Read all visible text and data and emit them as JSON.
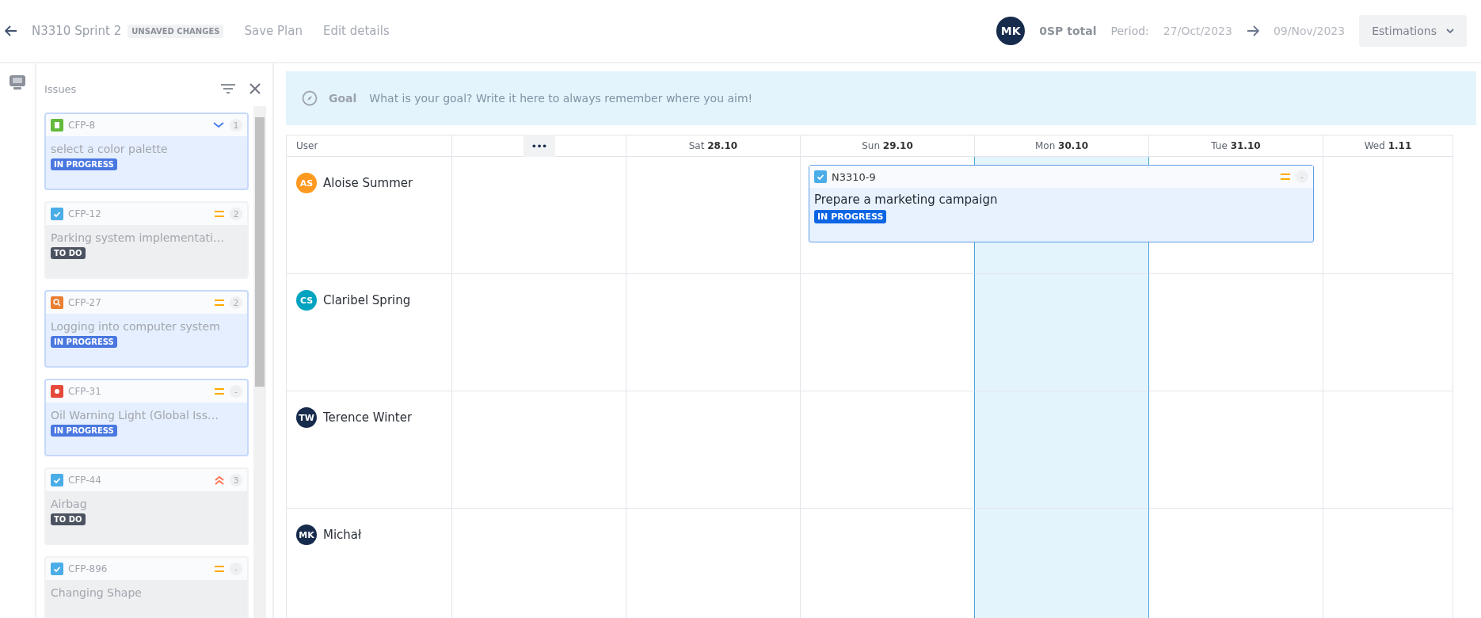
{
  "header": {
    "title": "N3310 Sprint 2",
    "badge": "UNSAVED CHANGES",
    "links": [
      "Save Plan",
      "Edit details"
    ],
    "avatar": {
      "initials": "MK",
      "color": "#172b4d"
    },
    "total": "0SP total",
    "period_label": "Period:",
    "period_start": "27/Oct/2023",
    "period_end": "09/Nov/2023",
    "button": "Estimations"
  },
  "sidebar": {
    "title": "Issues",
    "issues": [
      {
        "key": "CFP-8",
        "kind": "in_progress",
        "type_icon": {
          "kind": "story"
        },
        "priority_icon": {
          "kind": "low"
        },
        "points": "1",
        "title": "select a color palette",
        "status": "IN PROGRESS"
      },
      {
        "key": "CFP-12",
        "kind": "todo",
        "type_icon": {
          "kind": "task"
        },
        "priority_icon": {
          "kind": "medium"
        },
        "points": "2",
        "title": "Parking system implementati…",
        "status": "TO DO"
      },
      {
        "key": "CFP-27",
        "kind": "in_progress",
        "type_icon": {
          "kind": "search"
        },
        "priority_icon": {
          "kind": "medium"
        },
        "points": "2",
        "title": "Logging into computer system",
        "status": "IN PROGRESS"
      },
      {
        "key": "CFP-31",
        "kind": "in_progress",
        "type_icon": {
          "kind": "bug"
        },
        "priority_icon": {
          "kind": "medium"
        },
        "points": "-",
        "title": "Oil Warning Light (Global Iss…",
        "status": "IN PROGRESS"
      },
      {
        "key": "CFP-44",
        "kind": "todo",
        "type_icon": {
          "kind": "task"
        },
        "priority_icon": {
          "kind": "high"
        },
        "points": "3",
        "title": "Airbag",
        "status": "TO DO"
      },
      {
        "key": "CFP-896",
        "kind": "todo",
        "type_icon": {
          "kind": "task"
        },
        "priority_icon": {
          "kind": "medium"
        },
        "points": "-",
        "title": "Changing Shape"
      }
    ]
  },
  "goal": {
    "label": "Goal",
    "placeholder": "What is your goal? Write it here to always remember where you aim!"
  },
  "grid": {
    "user_header": "User",
    "more": "•••",
    "days": [
      {
        "weekday": "Sat",
        "date": "28.10",
        "today": false
      },
      {
        "weekday": "Sun",
        "date": "29.10",
        "today": false
      },
      {
        "weekday": "Mon",
        "date": "30.10",
        "today": true
      },
      {
        "weekday": "Tue",
        "date": "31.10",
        "today": false
      },
      {
        "weekday": "Wed",
        "date": "1.11",
        "today": false
      }
    ],
    "rows": [
      {
        "initials": "AS",
        "name": "Aloise Summer",
        "color": "#ff991f",
        "tasks": [
          {
            "key": "N3310-9",
            "type_icon": {
              "kind": "task"
            },
            "priority_icon": {
              "kind": "medium"
            },
            "points": "-",
            "title": "Prepare a marketing campaign",
            "status": "IN PROGRESS"
          }
        ]
      },
      {
        "initials": "CS",
        "name": "Claribel Spring",
        "color": "#00a3bf",
        "tasks": []
      },
      {
        "initials": "TW",
        "name": "Terence Winter",
        "color": "#172b4d",
        "tasks": []
      },
      {
        "initials": "MK",
        "name": "Michał",
        "color": "#172b4d",
        "tasks": []
      }
    ]
  }
}
